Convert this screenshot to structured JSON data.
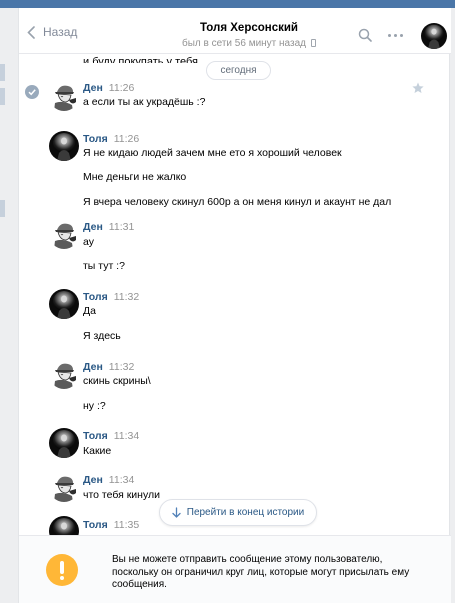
{
  "header": {
    "back_label": "Назад",
    "title": "Толя Херсонский",
    "status": "был в сети 56 минут назад"
  },
  "cut_text": "и буду покупать у тебя",
  "date_pill": "сегодня",
  "messages": [
    {
      "name": "Ден",
      "time": "11:26",
      "lines": [
        "а если ты ак украдёшь :?"
      ]
    },
    {
      "name": "Толя",
      "time": "11:26",
      "lines": [
        "Я не кидаю людей зачем мне ето я хороший человек",
        "Мне деньги не жалко",
        "Я вчера человеку скинул 600р а он меня кинул и акаунт не дал"
      ]
    },
    {
      "name": "Ден",
      "time": "11:31",
      "lines": [
        "ау",
        "ты тут :?"
      ]
    },
    {
      "name": "Толя",
      "time": "11:32",
      "lines": [
        "Да",
        "Я здесь"
      ]
    },
    {
      "name": "Ден",
      "time": "11:32",
      "lines": [
        "скинь скрины\\",
        "ну :?"
      ]
    },
    {
      "name": "Толя",
      "time": "11:34",
      "lines": [
        "Какие"
      ]
    },
    {
      "name": "Ден",
      "time": "11:34",
      "lines": [
        "что тебя кинули"
      ]
    },
    {
      "name": "Толя",
      "time": "11:35",
      "lines": []
    }
  ],
  "goto_end_label": "Перейти в конец истории",
  "footer_text": "Вы не можете отправить сообщение этому пользователю, поскольку он ограничил круг лиц, которые могут присылать ему сообщения.",
  "icons": {
    "back": "chevron-left-icon",
    "search": "search-icon",
    "more": "more-horizontal-icon",
    "star": "star-icon",
    "read": "check-circle-icon",
    "down": "arrow-down-icon",
    "warning": "warning-icon",
    "phone": "phone-icon"
  },
  "colors": {
    "accent": "#4a76a8",
    "name": "#2a5885",
    "warning": "#ffb737"
  }
}
